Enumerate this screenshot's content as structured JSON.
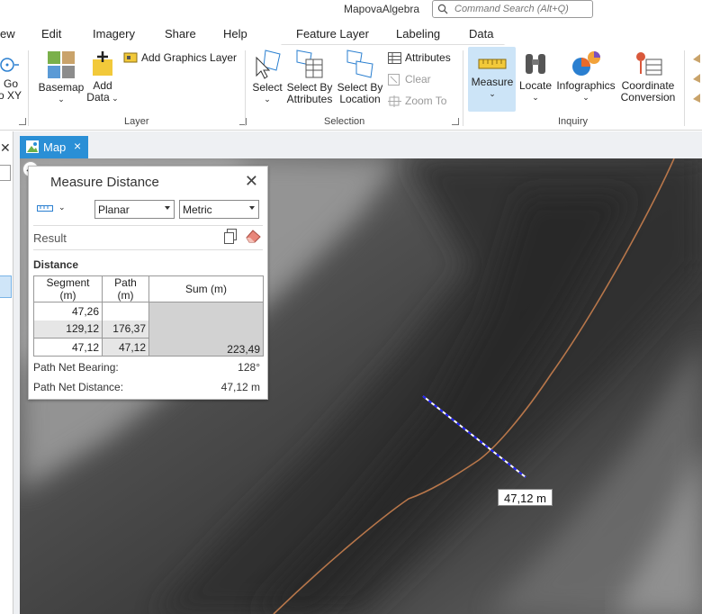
{
  "app": {
    "title": "MapovaAlgebra"
  },
  "search": {
    "placeholder": "Command Search (Alt+Q)"
  },
  "menu": {
    "view": "ew",
    "edit": "Edit",
    "imagery": "Imagery",
    "share": "Share",
    "help": "Help",
    "feature_layer": "Feature Layer",
    "labeling": "Labeling",
    "data": "Data"
  },
  "ribbon": {
    "goto_xy": {
      "line1": "Go",
      "line2": "o XY"
    },
    "basemap": "Basemap",
    "add_data": {
      "line1": "Add",
      "line2": "Data"
    },
    "add_graphics_layer": "Add Graphics Layer",
    "layer_group": "Layer",
    "select": "Select",
    "select_by_attributes": {
      "line1": "Select By",
      "line2": "Attributes"
    },
    "select_by_location": {
      "line1": "Select By",
      "line2": "Location"
    },
    "attributes": "Attributes",
    "clear": "Clear",
    "zoom_to": "Zoom To",
    "selection_group": "Selection",
    "measure": "Measure",
    "locate": "Locate",
    "infographics": "Infographics",
    "coordinate_conversion": {
      "line1": "Coordinate",
      "line2": "Conversion"
    },
    "inquiry_group": "Inquiry"
  },
  "tab": {
    "label": "Map",
    "close": "×"
  },
  "measure": {
    "title": "Measure Distance",
    "mode": "Planar",
    "units": "Metric",
    "result_label": "Result",
    "distance_label": "Distance",
    "headers": [
      "Segment (m)",
      "Path (m)",
      "Sum (m)"
    ],
    "rows": [
      {
        "segment": "47,26",
        "path": "",
        "sum": ""
      },
      {
        "segment": "129,12",
        "path": "176,37",
        "sum": ""
      },
      {
        "segment": "47,12",
        "path": "47,12",
        "sum": "223,49"
      }
    ],
    "bearing_label": "Path Net Bearing:",
    "bearing_value": "128°",
    "net_distance_label": "Path Net Distance:",
    "net_distance_value": "47,12 m"
  },
  "map_label": "47,12 m",
  "colors": {
    "accent": "#2a8fd6",
    "path_line": "#b7764a",
    "measure_line": "#1f1fff"
  }
}
